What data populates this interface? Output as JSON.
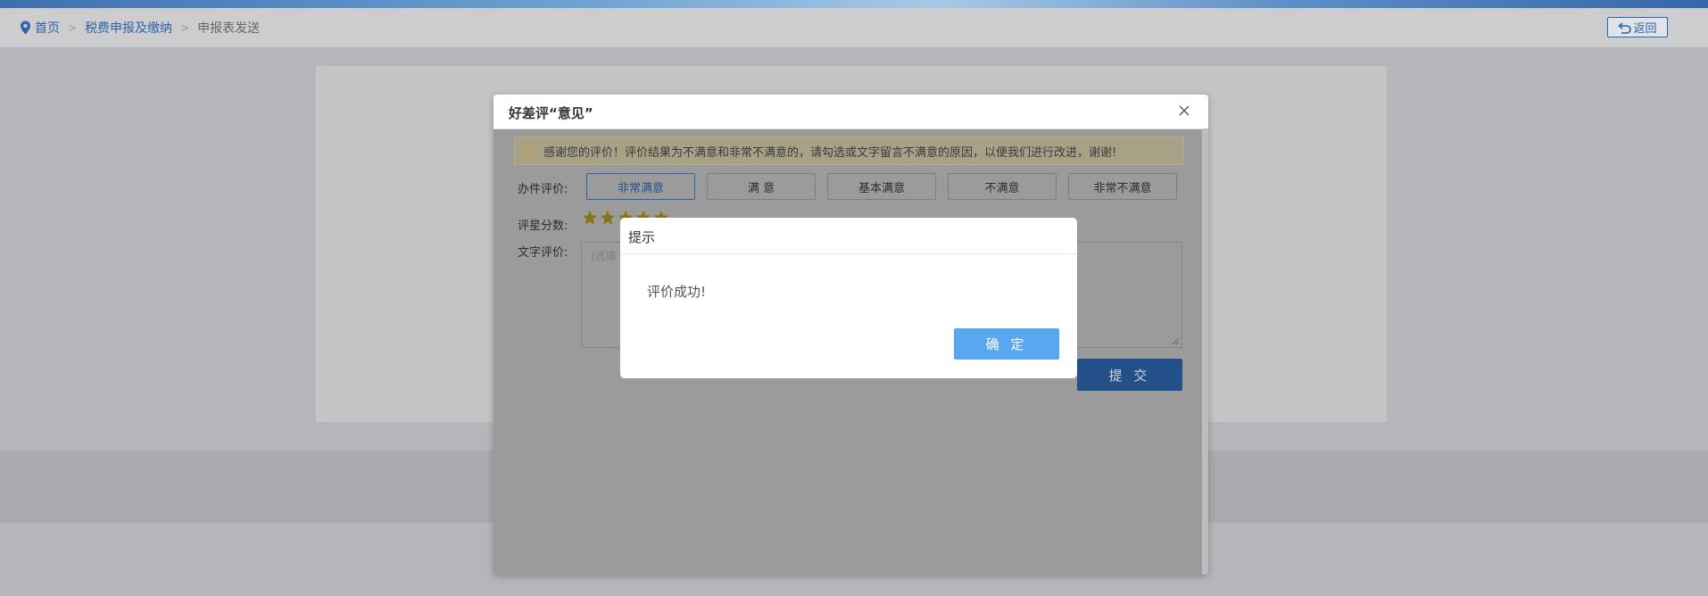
{
  "breadcrumb": {
    "home": "首页",
    "section": "税费申报及缴纳",
    "current": "申报表发送",
    "separator": ">"
  },
  "back_button": {
    "label": "返回"
  },
  "eval_modal": {
    "title": "好差评“意见”",
    "notice": "感谢您的评价！评价结果为不满意和非常不满意的，请勾选或文字留言不满意的原因，以便我们进行改进，谢谢!",
    "rating_label": "办件评价:",
    "options": [
      "非常满意",
      "满 意",
      "基本满意",
      "不满意",
      "非常不满意"
    ],
    "selected_option": "非常满意",
    "score_label": "评星分数:",
    "stars": 5,
    "text_label": "文字评价:",
    "text_placeholder": "(选填",
    "submit_label": "提 交"
  },
  "tip_dialog": {
    "title": "提示",
    "message": "评价成功!",
    "ok_label": "确 定"
  },
  "colors": {
    "accent": "#2f63a8",
    "ok_button": "#58a7ef",
    "star": "#e8b400"
  }
}
